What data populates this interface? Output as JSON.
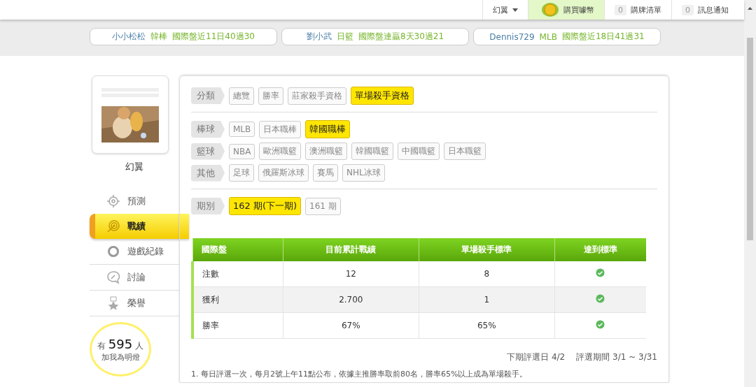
{
  "top_bar": {
    "user_menu": "幻翼",
    "buy_coins": "購買噱幣",
    "cart": {
      "count": "0",
      "label": "購牌清單"
    },
    "messages": {
      "count": "0",
      "label": "訊息通知"
    }
  },
  "ticker": [
    {
      "user": "小小松松",
      "league": "韓棒",
      "record": "國際盤近11日40過30"
    },
    {
      "user": "劉小武",
      "league": "日籃",
      "record": "國際盤連贏8天30過21"
    },
    {
      "user": "Dennis729",
      "league": "MLB",
      "record": "國際盤近18日41過31"
    }
  ],
  "profile": {
    "username": "幻翼",
    "fans": {
      "prefix": "有",
      "count": "595",
      "suffix": "人",
      "caption": "加我為明燈"
    }
  },
  "nav": [
    {
      "label": "預測",
      "kind": "crosshair",
      "selected": false
    },
    {
      "label": "戰績",
      "kind": "target",
      "selected": true
    },
    {
      "label": "遊戲紀錄",
      "kind": "ring",
      "selected": false
    },
    {
      "label": "討論",
      "kind": "chat",
      "selected": false
    },
    {
      "label": "榮譽",
      "kind": "medal",
      "selected": false
    }
  ],
  "filters": [
    {
      "label": "分類",
      "options": [
        {
          "label": "總覽",
          "selected": false
        },
        {
          "label": "勝率",
          "selected": false
        },
        {
          "label": "莊家殺手資格",
          "selected": false
        },
        {
          "label": "單場殺手資格",
          "selected": true
        }
      ]
    },
    {
      "label": "棒球",
      "options": [
        {
          "label": "MLB",
          "selected": false
        },
        {
          "label": "日本職棒",
          "selected": false
        },
        {
          "label": "韓國職棒",
          "selected": true
        }
      ]
    },
    {
      "label": "籃球",
      "options": [
        {
          "label": "NBA",
          "selected": false
        },
        {
          "label": "歐洲職籃",
          "selected": false
        },
        {
          "label": "澳洲職籃",
          "selected": false
        },
        {
          "label": "韓國職籃",
          "selected": false
        },
        {
          "label": "中國職籃",
          "selected": false
        },
        {
          "label": "日本職籃",
          "selected": false
        }
      ]
    },
    {
      "label": "其他",
      "options": [
        {
          "label": "足球",
          "selected": false
        },
        {
          "label": "俄羅斯冰球",
          "selected": false
        },
        {
          "label": "賽馬",
          "selected": false
        },
        {
          "label": "NHL冰球",
          "selected": false
        }
      ]
    },
    {
      "label": "期別",
      "options": [
        {
          "label": "162 期(下一期)",
          "selected": true
        },
        {
          "label": "161 期",
          "selected": false
        }
      ]
    }
  ],
  "table": {
    "columns": [
      "國際盤",
      "目前累計戰績",
      "單場殺手標準",
      "達到標準"
    ],
    "rows": [
      {
        "metric": "注數",
        "current": "12",
        "standard": "8",
        "met": true
      },
      {
        "metric": "獲利",
        "current": "2.700",
        "standard": "1",
        "met": true
      },
      {
        "metric": "勝率",
        "current": "67%",
        "standard": "65%",
        "met": true
      }
    ]
  },
  "schedule": {
    "next_date": "下期評選日 4/2",
    "period": "評選期間 3/1 ~ 3/31"
  },
  "note": "1. 每日評選一次，每月2號上午11點公布，依據主推勝率取前80名，勝率65%以上成為單場殺手。"
}
